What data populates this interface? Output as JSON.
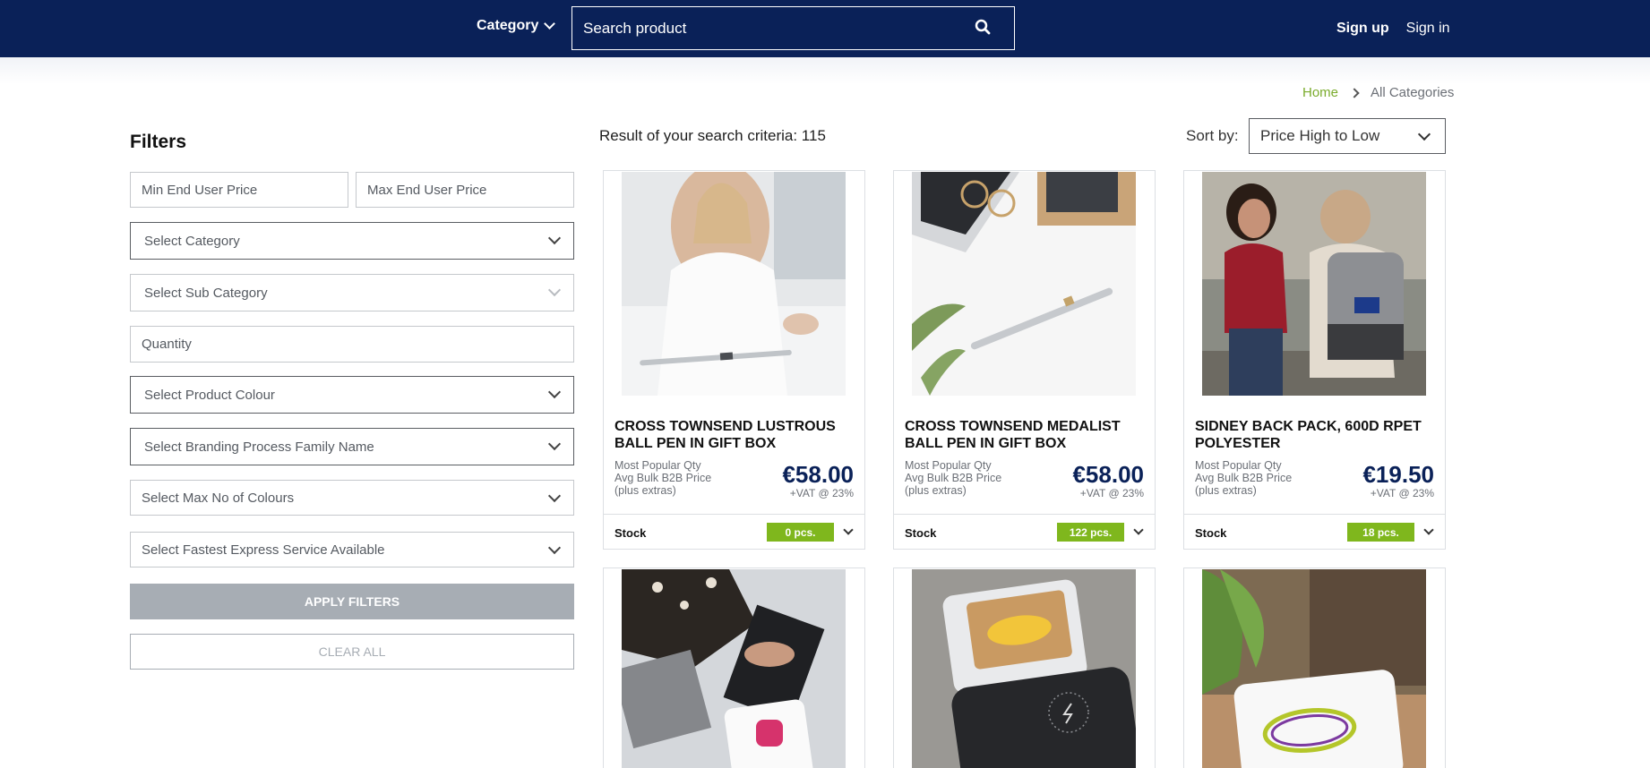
{
  "nav": {
    "category_label": "Category",
    "search_placeholder": "Search product",
    "signup": "Sign up",
    "signin": "Sign in"
  },
  "breadcrumb": {
    "home": "Home",
    "current": "All Categories"
  },
  "filters": {
    "title": "Filters",
    "min_price_placeholder": "Min End User Price",
    "max_price_placeholder": "Max End User Price",
    "category": "Select Category",
    "sub_category": "Select Sub Category",
    "quantity_placeholder": "Quantity",
    "colour": "Select Product Colour",
    "branding": "Select Branding Process Family Name",
    "max_colours": "Select Max No of Colours",
    "express": "Select Fastest Express Service Available",
    "apply": "APPLY FILTERS",
    "clear": "CLEAR ALL"
  },
  "results": {
    "summary": "Result of your search criteria: 115",
    "sort_label": "Sort by:",
    "sort_value": "Price High to Low"
  },
  "products": [
    {
      "name": "CROSS TOWNSEND LUSTROUS BALL PEN IN GIFT BOX",
      "meta_line1": "Most Popular Qty",
      "meta_line2": "Avg Bulk B2B Price",
      "meta_line3": "(plus extras)",
      "price": "€58.00",
      "vat": "+VAT @ 23%",
      "stock_label": "Stock",
      "stock": "0 pcs."
    },
    {
      "name": "CROSS TOWNSEND MEDALIST BALL PEN IN GIFT BOX",
      "meta_line1": "Most Popular Qty",
      "meta_line2": "Avg Bulk B2B Price",
      "meta_line3": "(plus extras)",
      "price": "€58.00",
      "vat": "+VAT @ 23%",
      "stock_label": "Stock",
      "stock": "122 pcs."
    },
    {
      "name": "SIDNEY BACK PACK, 600D RPET POLYESTER",
      "meta_line1": "Most Popular Qty",
      "meta_line2": "Avg Bulk B2B Price",
      "meta_line3": "(plus extras)",
      "price": "€19.50",
      "vat": "+VAT @ 23%",
      "stock_label": "Stock",
      "stock": "18 pcs."
    }
  ],
  "colors": {
    "navbar": "#0a2158",
    "accent_green": "#7fb71d",
    "price_blue": "#0a2158",
    "breadcrumb_home": "#7aab2c"
  }
}
